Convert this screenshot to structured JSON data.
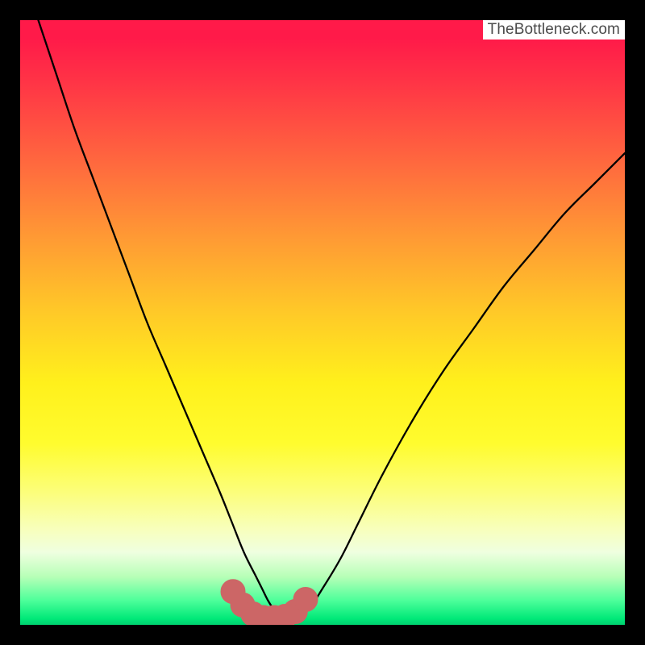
{
  "watermark": {
    "text": "TheBottleneck.com"
  },
  "colors": {
    "curve_stroke": "#000000",
    "marker_fill": "#cc6666",
    "marker_stroke": "#cc6666"
  },
  "chart_data": {
    "type": "line",
    "title": "",
    "xlabel": "",
    "ylabel": "",
    "xlim": [
      0,
      100
    ],
    "ylim": [
      0,
      100
    ],
    "series": [
      {
        "name": "bottleneck-curve",
        "x": [
          3,
          6,
          9,
          12,
          15,
          18,
          21,
          24,
          27,
          30,
          33,
          35,
          37,
          39,
          40,
          41,
          42,
          43,
          44,
          45,
          46,
          48,
          50,
          53,
          56,
          60,
          65,
          70,
          75,
          80,
          85,
          90,
          95,
          100
        ],
        "y": [
          100,
          91,
          82,
          74,
          66,
          58,
          50,
          43,
          36,
          29,
          22,
          17,
          12,
          8,
          6,
          4,
          2.5,
          1.5,
          1,
          1,
          1.5,
          3,
          6,
          11,
          17,
          25,
          34,
          42,
          49,
          56,
          62,
          68,
          73,
          78
        ]
      }
    ],
    "markers": {
      "name": "highlighted-bottom",
      "x": [
        35.2,
        36.8,
        38.5,
        40.2,
        42.0,
        43.8,
        45.5,
        47.2
      ],
      "y": [
        5.5,
        3.3,
        1.8,
        1.2,
        1.2,
        1.4,
        2.2,
        4.2
      ],
      "r": 2.0
    }
  }
}
